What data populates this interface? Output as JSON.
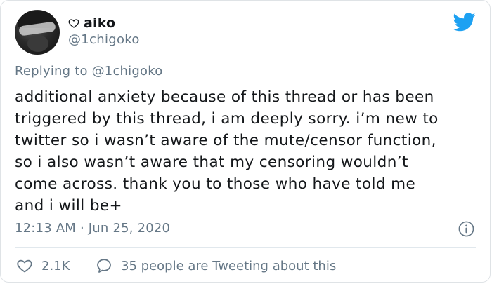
{
  "user": {
    "display_name": "aiko",
    "name_prefix_icon": "heart-outline-icon",
    "handle": "@1chigoko"
  },
  "reply_context": {
    "prefix": "Replying to",
    "mention": "@1chigoko"
  },
  "tweet": {
    "text": "additional anxiety because of this thread or has been\ntriggered by this thread, i am deeply sorry. i’m new to\ntwitter so i wasn’t aware of the mute/censor function,\nso i also wasn’t aware that my censoring wouldn’t\ncome across. thank you to those who have told me\nand i will be+",
    "timestamp": "12:13 AM · Jun 25, 2020"
  },
  "actions": {
    "likes": "2.1K",
    "reply_label": "35 people are Tweeting about this"
  },
  "icons": {
    "brand": "twitter-bird-icon",
    "info": "info-icon",
    "like": "heart-outline-icon",
    "reply": "speech-bubble-icon"
  },
  "colors": {
    "brand": "#1da1f2",
    "text_primary": "#14171a",
    "text_secondary": "#657786",
    "divider": "#e1e8ed"
  }
}
